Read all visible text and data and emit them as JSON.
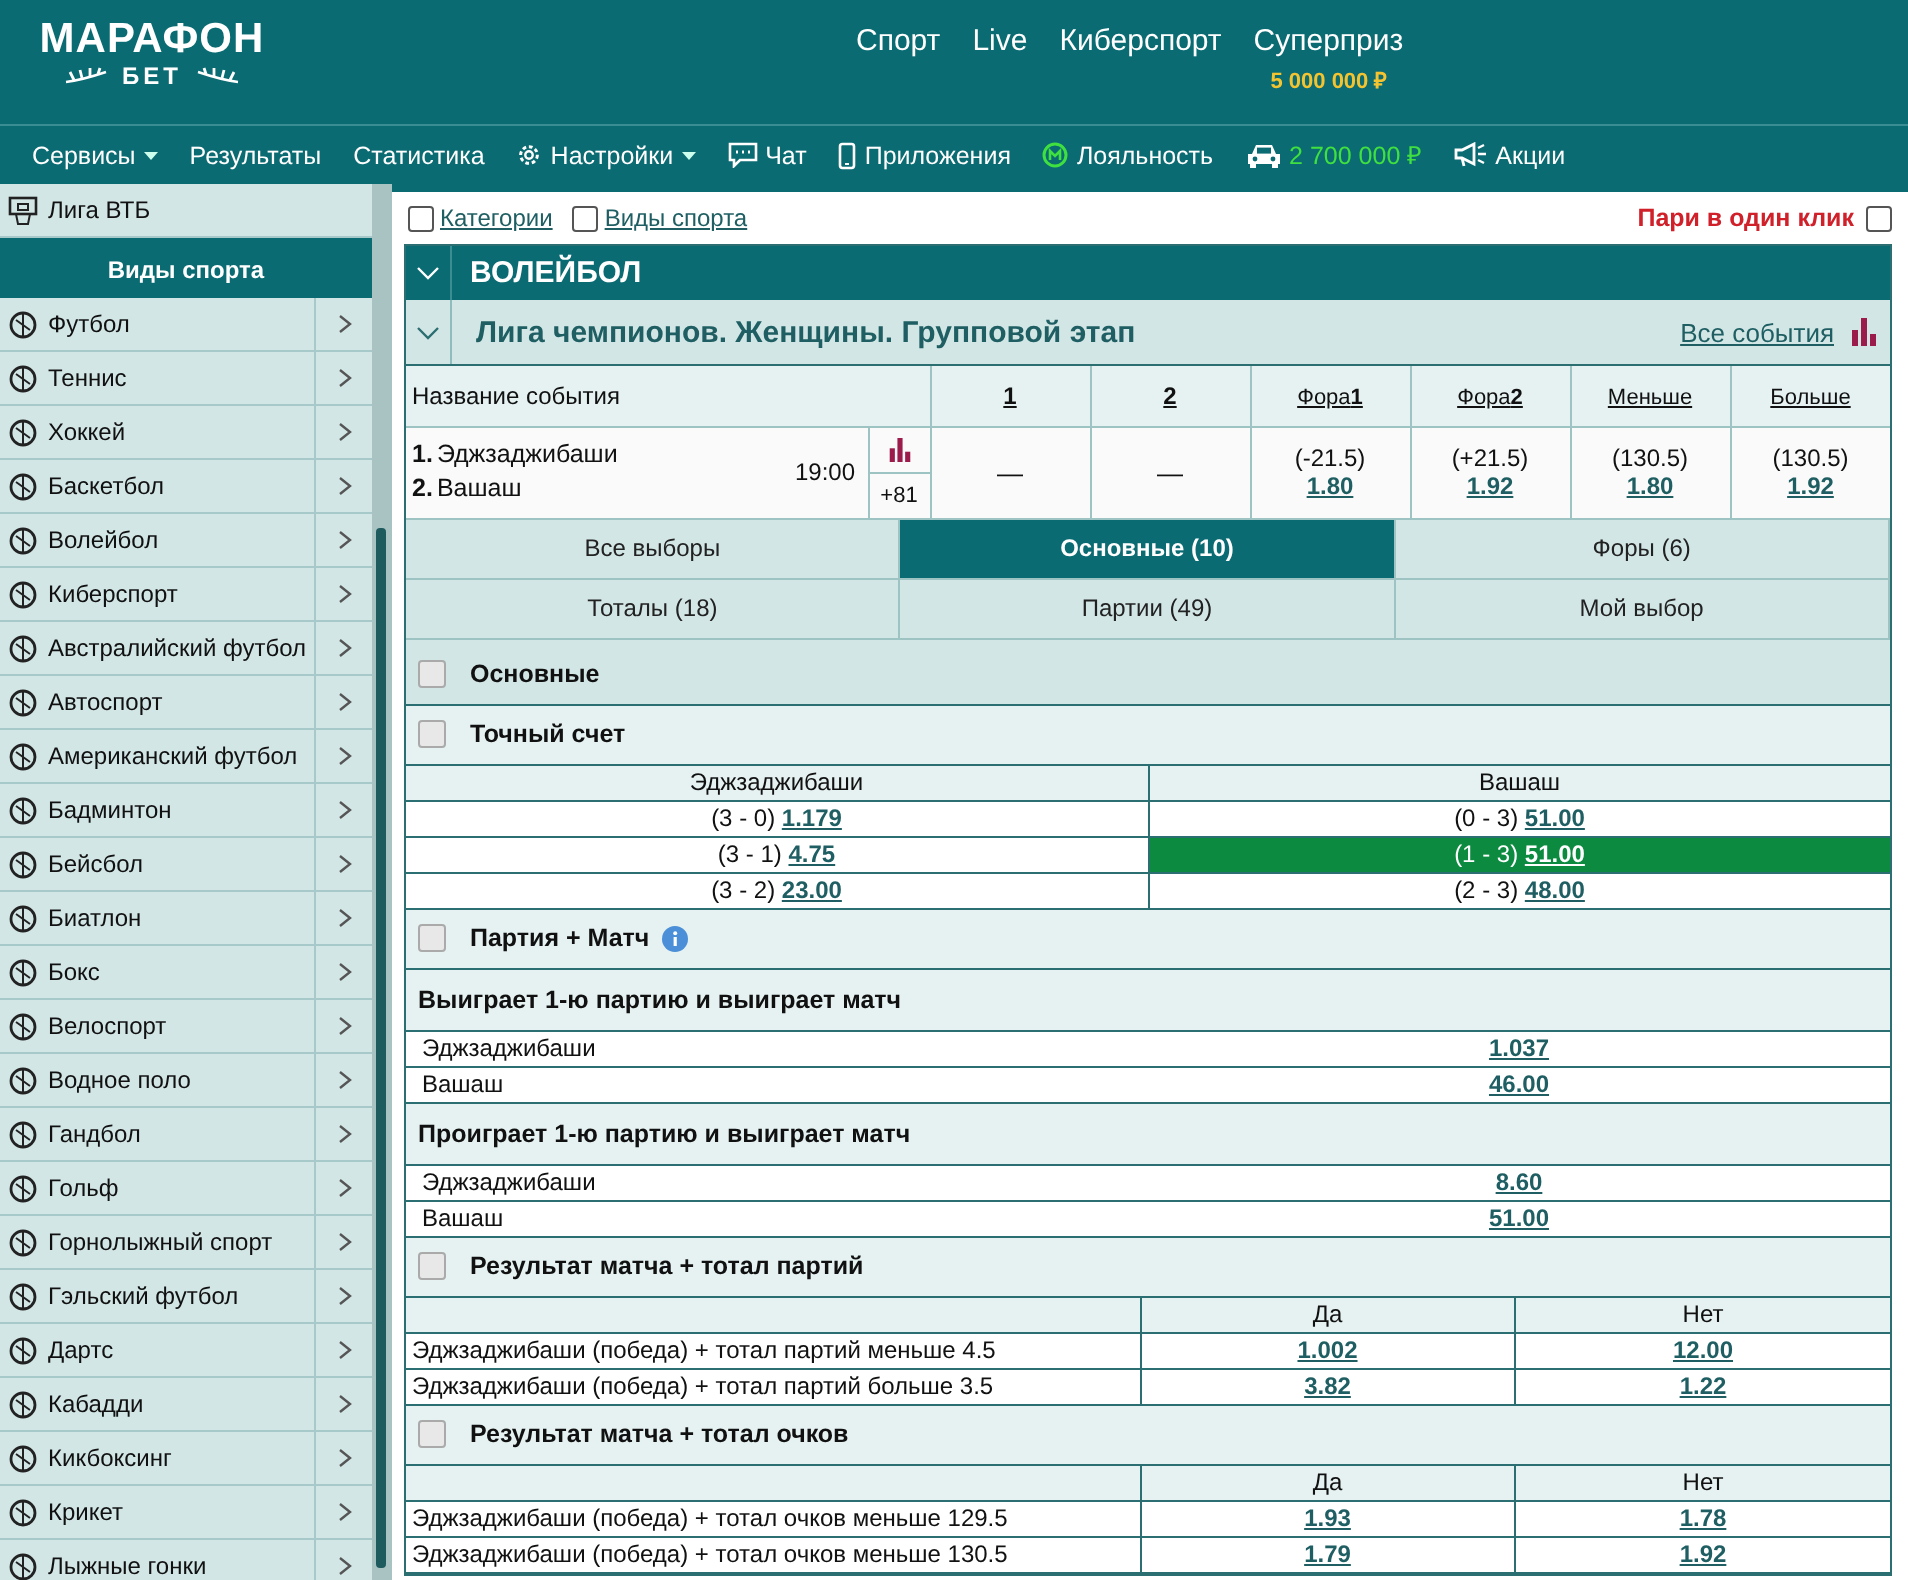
{
  "header": {
    "logo_title": "МАРАФОН",
    "logo_subtitle": "БЕТ",
    "nav": [
      {
        "label": "Спорт"
      },
      {
        "label": "Live"
      },
      {
        "label": "Киберспорт"
      },
      {
        "label": "Суперприз",
        "sublabel": "5 000 000 ₽"
      }
    ]
  },
  "menu": [
    {
      "label": "Сервисы",
      "kind": "dropdown"
    },
    {
      "label": "Результаты",
      "kind": "plain"
    },
    {
      "label": "Статистика",
      "kind": "plain"
    },
    {
      "label": "Настройки",
      "kind": "settings"
    },
    {
      "label": "Чат",
      "kind": "chat"
    },
    {
      "label": "Приложения",
      "kind": "phone"
    },
    {
      "label": "Лояльность",
      "kind": "loyalty"
    },
    {
      "label": "2 700 000 ₽",
      "kind": "car"
    },
    {
      "label": "Акции",
      "kind": "promo"
    }
  ],
  "sidebar": {
    "top_item": "Лига ВТБ",
    "heading": "Виды спорта",
    "items": [
      {
        "label": "Футбол"
      },
      {
        "label": "Теннис"
      },
      {
        "label": "Хоккей"
      },
      {
        "label": "Баскетбол"
      },
      {
        "label": "Волейбол"
      },
      {
        "label": "Киберспорт"
      },
      {
        "label": "Австралийский футбол"
      },
      {
        "label": "Автоспорт"
      },
      {
        "label": "Американский футбол"
      },
      {
        "label": "Бадминтон"
      },
      {
        "label": "Бейсбол"
      },
      {
        "label": "Биатлон"
      },
      {
        "label": "Бокс"
      },
      {
        "label": "Велоспорт"
      },
      {
        "label": "Водное поло"
      },
      {
        "label": "Гандбол"
      },
      {
        "label": "Гольф"
      },
      {
        "label": "Горнолыжный спорт"
      },
      {
        "label": "Гэльский футбол"
      },
      {
        "label": "Дартс"
      },
      {
        "label": "Кабадди"
      },
      {
        "label": "Кикбоксинг"
      },
      {
        "label": "Крикет"
      },
      {
        "label": "Лыжные гонки"
      }
    ]
  },
  "filters": {
    "checkboxes": [
      {
        "label": "Категории",
        "checked": false
      },
      {
        "label": "Виды спорта",
        "checked": false
      }
    ],
    "one_click": {
      "label": "Пари в один клик",
      "checked": false
    }
  },
  "sport": {
    "title": "ВОЛЕЙБОЛ"
  },
  "league": {
    "title": "Лига чемпионов. Женщины. Групповой этап",
    "all_events": "Все события"
  },
  "columns": [
    "Название события",
    "1",
    "2",
    "Фора**1**",
    "Фора**2**",
    "Меньше",
    "Больше"
  ],
  "event": {
    "teams": [
      {
        "no": "1.",
        "name": "Эджзаджибаши"
      },
      {
        "no": "2.",
        "name": "Вашаш"
      }
    ],
    "time": "19:00",
    "more": "+81",
    "odds": [
      {
        "value": "—"
      },
      {
        "value": "—"
      },
      {
        "line": "(-21.5)",
        "value": "1.80"
      },
      {
        "line": "(+21.5)",
        "value": "1.92"
      },
      {
        "line": "(130.5)",
        "value": "1.80"
      },
      {
        "line": "(130.5)",
        "value": "1.92"
      }
    ]
  },
  "tabs": [
    {
      "label": "Все выборы",
      "selected": false
    },
    {
      "label": "Основные (10)",
      "selected": true
    },
    {
      "label": "Форы (6)",
      "selected": false
    },
    {
      "label": "Тоталы (18)",
      "selected": false
    },
    {
      "label": "Партии (49)",
      "selected": false
    },
    {
      "label": "Мой выбор",
      "selected": false
    }
  ],
  "markets": [
    {
      "kind": "group",
      "title": "Основные",
      "checked": false
    },
    {
      "kind": "market",
      "title": "Точный счет",
      "checked": false,
      "info": false
    },
    {
      "kind": "score_grid",
      "columns": [
        "Эджзаджибаши",
        "Вашаш"
      ],
      "rows": [
        [
          {
            "score": "(3 - 0)",
            "odd": "1.179",
            "selected": false
          },
          {
            "score": "(0 - 3)",
            "odd": "51.00",
            "selected": false
          }
        ],
        [
          {
            "score": "(3 - 1)",
            "odd": "4.75",
            "selected": false
          },
          {
            "score": "(1 - 3)",
            "odd": "51.00",
            "selected": true
          }
        ],
        [
          {
            "score": "(3 - 2)",
            "odd": "23.00",
            "selected": false
          },
          {
            "score": "(2 - 3)",
            "odd": "48.00",
            "selected": false
          }
        ]
      ]
    },
    {
      "kind": "market",
      "title": "Партия + Матч",
      "checked": false,
      "info": true
    },
    {
      "kind": "subheading",
      "title": "Выиграет 1-ю партию и выиграет матч"
    },
    {
      "kind": "list",
      "rows": [
        {
          "label": "Эджзаджибаши",
          "odd": "1.037"
        },
        {
          "label": "Вашаш",
          "odd": "46.00"
        }
      ]
    },
    {
      "kind": "subheading",
      "title": "Проиграет 1-ю партию и выиграет матч"
    },
    {
      "kind": "list",
      "rows": [
        {
          "label": "Эджзаджибаши",
          "odd": "8.60"
        },
        {
          "label": "Вашаш",
          "odd": "51.00"
        }
      ]
    },
    {
      "kind": "market",
      "title": "Результат матча + тотал партий",
      "checked": false,
      "info": false
    },
    {
      "kind": "yes_no",
      "columns": [
        "Да",
        "Нет"
      ],
      "rows": [
        {
          "label": "Эджзаджибаши (победа) + тотал партий меньше 4.5",
          "odds": [
            "1.002",
            "12.00"
          ]
        },
        {
          "label": "Эджзаджибаши (победа) + тотал партий больше 3.5",
          "odds": [
            "3.82",
            "1.22"
          ]
        }
      ]
    },
    {
      "kind": "market",
      "title": "Результат матча + тотал очков",
      "checked": false,
      "info": false
    },
    {
      "kind": "yes_no",
      "columns": [
        "Да",
        "Нет"
      ],
      "rows": [
        {
          "label": "Эджзаджибаши (победа) + тотал очков меньше 129.5",
          "odds": [
            "1.93",
            "1.78"
          ]
        },
        {
          "label": "Эджзаджибаши (победа) + тотал очков меньше 130.5",
          "odds": [
            "1.79",
            "1.92"
          ]
        }
      ]
    }
  ]
}
